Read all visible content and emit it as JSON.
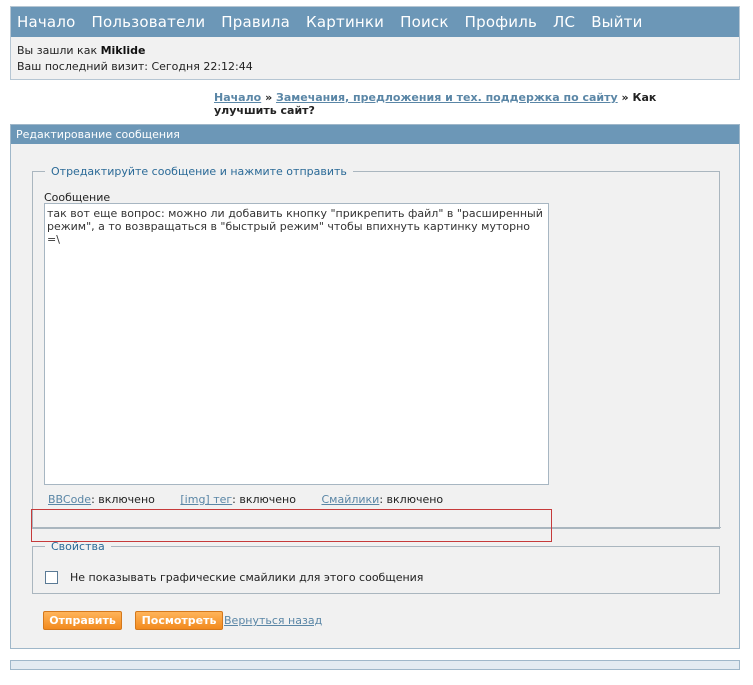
{
  "nav": {
    "items": [
      {
        "label": "Начало"
      },
      {
        "label": "Пользователи"
      },
      {
        "label": "Правила"
      },
      {
        "label": "Картинки"
      },
      {
        "label": "Поиск"
      },
      {
        "label": "Профиль"
      },
      {
        "label": "ЛС"
      },
      {
        "label": "Выйти"
      }
    ]
  },
  "welcome": {
    "logged_prefix": "Вы зашли как",
    "username": "Miklide",
    "last_visit": "Ваш последний визит: Сегодня 22:12:44"
  },
  "breadcrumb": {
    "home": "Начало",
    "sep": "»",
    "forum": "Замечания, предложения и тех. поддержка по сайту",
    "topic": "Как улучшить сайт?"
  },
  "editor": {
    "header": "Редактирование сообщения",
    "legend": "Отредактируйте сообщение и нажмите отправить",
    "message_label": "Сообщение",
    "message_text": "так вот еще вопрос: можно ли добавить кнопку \"прикрепить файл\" в \"расширенный режим\", а то возвращаться в \"быстрый режим\" чтобы впихнуть картинку муторно =\\",
    "status": {
      "bbcode_link": "BBCode",
      "bbcode_value": ": включено",
      "img_link": "[img] тег",
      "img_value": ": включено",
      "smilies_link": "Смайлики",
      "smilies_value": ": включено"
    }
  },
  "properties": {
    "legend": "Свойства",
    "hide_smilies_label": "Не показывать графические смайлики для этого сообщения",
    "hide_smilies_checked": false
  },
  "actions": {
    "send": "Отправить",
    "preview": "Посмотреть",
    "back": "Вернуться назад"
  },
  "colors": {
    "header_bar": "#6c97b7",
    "link": "#5a86a6",
    "button": "#f28a1e",
    "highlight_box": "#c63b3b"
  }
}
